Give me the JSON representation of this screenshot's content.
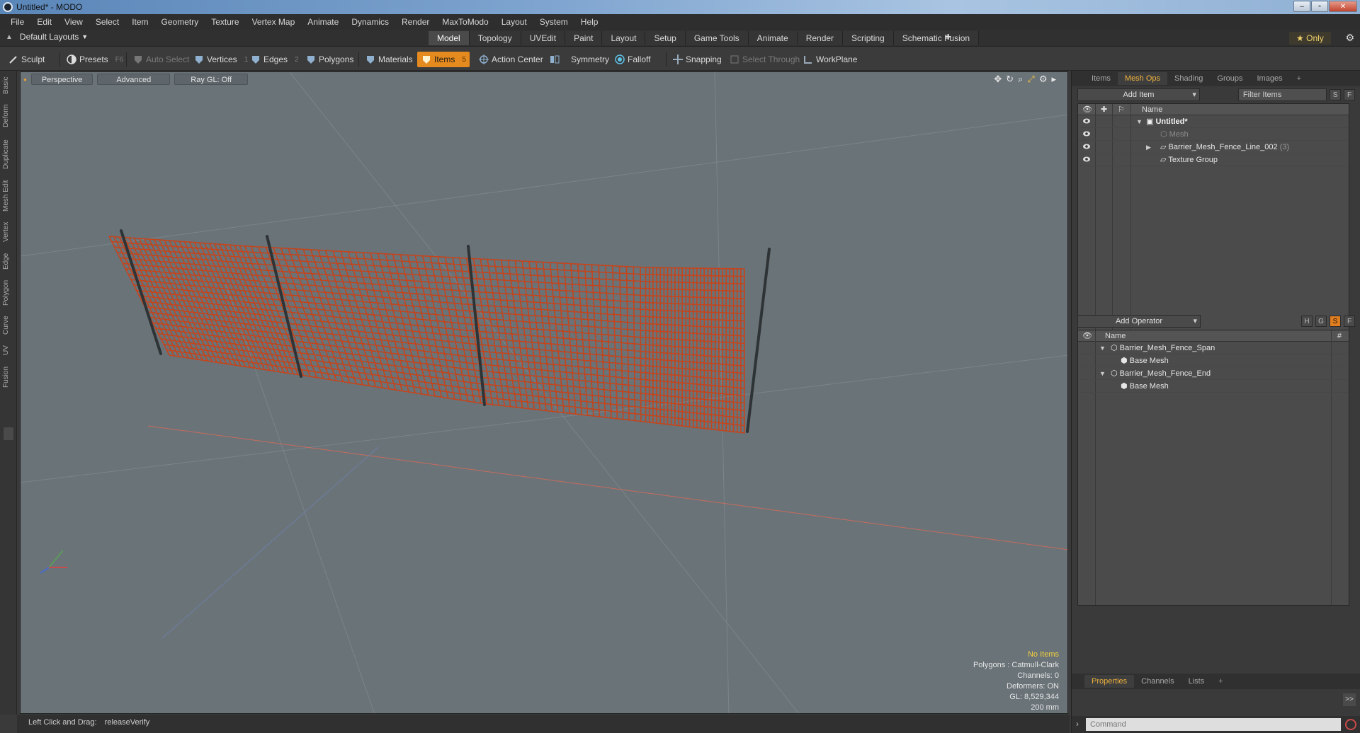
{
  "window": {
    "title": "Untitled* - MODO",
    "min": "–",
    "max": "▫",
    "close": "✕"
  },
  "menu": [
    "File",
    "Edit",
    "View",
    "Select",
    "Item",
    "Geometry",
    "Texture",
    "Vertex Map",
    "Animate",
    "Dynamics",
    "Render",
    "MaxToModo",
    "Layout",
    "System",
    "Help"
  ],
  "layoutbar": {
    "layout_label": "Default Layouts",
    "tabs": [
      "Model",
      "Topology",
      "UVEdit",
      "Paint",
      "Layout",
      "Setup",
      "Game Tools",
      "Animate",
      "Render",
      "Scripting",
      "Schematic Fusion"
    ],
    "active_tab": "Model",
    "plus": "+",
    "only_label": "Only",
    "only_star": "★"
  },
  "toolbar": {
    "sculpt": "Sculpt",
    "presets": "Presets",
    "presets_key": "F6",
    "auto_select": "Auto Select",
    "vertices": "Vertices",
    "vertices_key": "1",
    "edges": "Edges",
    "edges_key": "2",
    "polygons": "Polygons",
    "materials": "Materials",
    "items": "Items",
    "items_key": "5",
    "action_center": "Action Center",
    "symmetry": "Symmetry",
    "falloff": "Falloff",
    "snapping": "Snapping",
    "select_through": "Select Through",
    "workplane": "WorkPlane"
  },
  "left_tabs": [
    "Basic",
    "Deform",
    "Duplicate",
    "Mesh Edit",
    "Vertex",
    "Edge",
    "Polygon",
    "Curve",
    "UV",
    "Fusion"
  ],
  "viewport": {
    "view_label": "Perspective",
    "shading_label": "Advanced",
    "raygl_label": "Ray GL: Off",
    "info": {
      "selection": "No Items",
      "polygons": "Polygons : Catmull-Clark",
      "channels": "Channels: 0",
      "deformers": "Deformers: ON",
      "gl": "GL: 8,529,344",
      "scale": "200 mm"
    }
  },
  "status": {
    "hint": "Left Click and Drag:",
    "action": "releaseVerify"
  },
  "items_panel": {
    "tabs": [
      "Items",
      "Mesh Ops",
      "Shading",
      "Groups",
      "Images",
      "+"
    ],
    "active_tab": "Mesh Ops",
    "add_item": "Add Item",
    "filter_placeholder": "Filter Items",
    "btn_s": "S",
    "btn_f": "F",
    "col_name": "Name",
    "rows": [
      {
        "label": "Untitled*",
        "style": "bold"
      },
      {
        "label": "Mesh",
        "style": "dim"
      },
      {
        "label": "Barrier_Mesh_Fence_Line_002",
        "count": "(3)",
        "style": "normal"
      },
      {
        "label": "Texture Group",
        "style": "normal"
      }
    ]
  },
  "meshops_panel": {
    "add_operator": "Add Operator",
    "btn_h": "H",
    "btn_g": "G",
    "btn_s": "S",
    "btn_f": "F",
    "col_name": "Name",
    "col_hash": "#",
    "rows": [
      {
        "label": "Barrier_Mesh_Fence_Span",
        "level": 0
      },
      {
        "label": "Base Mesh",
        "level": 1
      },
      {
        "label": "Barrier_Mesh_Fence_End",
        "level": 0
      },
      {
        "label": "Base Mesh",
        "level": 1
      }
    ]
  },
  "properties_panel": {
    "tabs": [
      "Properties",
      "Channels",
      "Lists",
      "+"
    ],
    "active_tab": "Properties",
    "expand": ">>"
  },
  "command": {
    "placeholder": "Command"
  },
  "colors": {
    "accent": "#e58a1e",
    "fence": "#c4441c",
    "viewport_bg": "#6a7378",
    "highlight": "#f5cf3c"
  }
}
